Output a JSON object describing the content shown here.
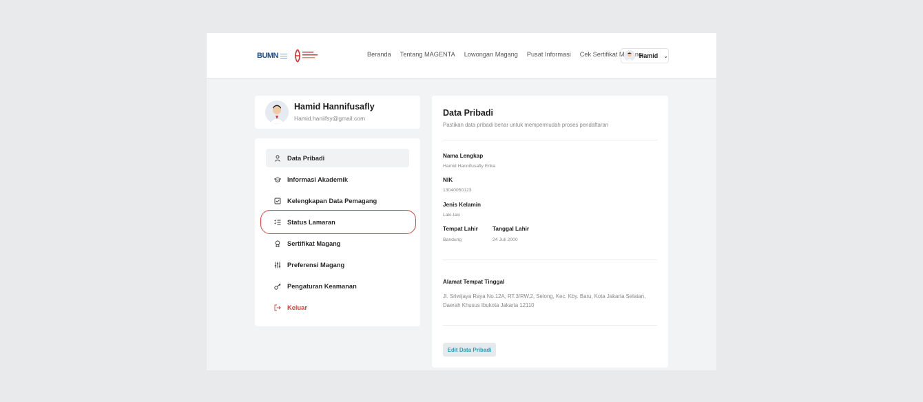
{
  "nav": {
    "brand_text": "BUMN",
    "links": [
      "Beranda",
      "Tentang MAGENTA",
      "Lowongan Magang",
      "Pusat Informasi",
      "Cek Sertifikat Magang"
    ],
    "user_name": "Hamid"
  },
  "profile": {
    "name": "Hamid Hannifusafly",
    "email": "Hamid.haniifsy@gmail.com"
  },
  "menu": {
    "items": [
      {
        "label": "Data Pribadi",
        "icon": "user-icon",
        "active": true
      },
      {
        "label": "Informasi Akademik",
        "icon": "graduation-cap-icon"
      },
      {
        "label": "Kelengkapan Data Pemagang",
        "icon": "checkbox-icon"
      },
      {
        "label": "Status Lamaran",
        "icon": "checklist-icon",
        "highlighted": true
      },
      {
        "label": "Sertifikat Magang",
        "icon": "award-icon"
      },
      {
        "label": "Preferensi Magang",
        "icon": "sliders-icon"
      },
      {
        "label": "Pengaturan Keamanan",
        "icon": "key-icon"
      },
      {
        "label": "Keluar",
        "icon": "logout-icon",
        "danger": true
      }
    ]
  },
  "detail": {
    "title": "Data Pribadi",
    "subtitle": "Pastikan data pribadi benar untuk mempermudah proses pendaftaran",
    "fields": {
      "nama_label": "Nama Lengkap",
      "nama_value": "Hamid Hannifusafly Erika",
      "nik_label": "NIK",
      "nik_value": "13040050123",
      "gender_label": "Jenis Kelamin",
      "gender_value": "Laki-laki",
      "tempat_label": "Tempat Lahir",
      "tempat_value": "Bandung",
      "tanggal_label": "Tanggal Lahir",
      "tanggal_value": "24 Juli 2000",
      "alamat_label": "Alamat Tempat Tinggal",
      "alamat_value": "Jl. Sriwijaya Raya No.12A, RT.3/RW.2, Selong, Kec. Kby. Baru, Kota Jakarta Selatan, Daerah Khusus Ibukota Jakarta 12110"
    },
    "edit_button": "Edit Data Pribadi"
  },
  "colors": {
    "accent": "#2a9db7",
    "danger": "#e0403b",
    "highlight": "#e5423d"
  }
}
